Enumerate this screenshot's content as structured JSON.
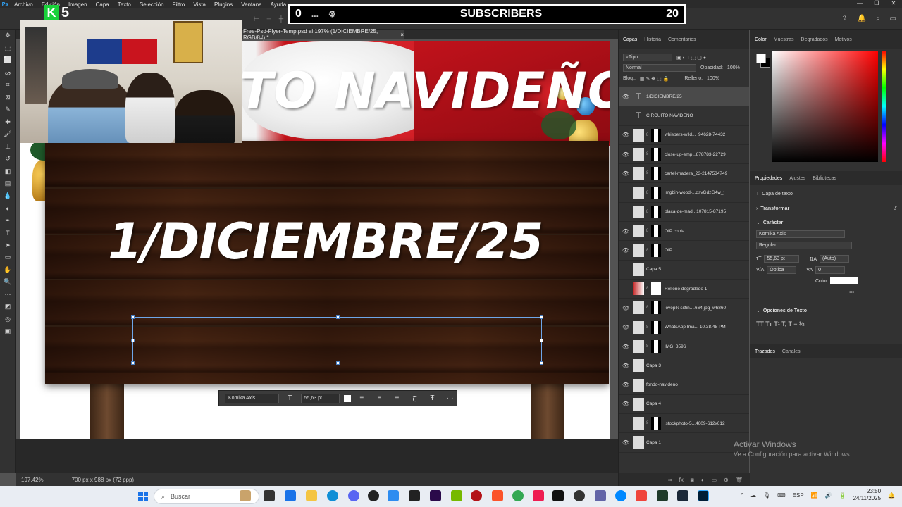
{
  "menubar": {
    "items": [
      "Archivo",
      "Edición",
      "Imagen",
      "Capa",
      "Texto",
      "Selección",
      "Filtro",
      "Vista",
      "Plugins",
      "Ventana",
      "Ayuda"
    ]
  },
  "overlay": {
    "logo_number": "5",
    "count_left": "0",
    "dots": "...",
    "label": "SUBSCRIBERS",
    "count_right": "20"
  },
  "document": {
    "tab_title": "Free-Psd-Flyer-Temp.psd al 197% (1/DICIEMBRE/25, RGB/8#) *",
    "tab_close": "×",
    "sign_title": "CIRCUITO NAVIDEÑO",
    "sign_date": "1/DICIEMBRE/25"
  },
  "float_bar": {
    "font": "Komika Axis",
    "size": "55,63 pt",
    "more": "···"
  },
  "statusbar": {
    "zoom": "197,42%",
    "size": "700 px x 988 px (72 ppp)"
  },
  "layers_panel": {
    "tabs": [
      "Capas",
      "Historia",
      "Comentarios"
    ],
    "filter": "Tipo",
    "blend_mode": "Normal",
    "opacity_label": "Opacidad:",
    "opacity_value": "100%",
    "lock_label": "Bloq.:",
    "fill_label": "Relleno:",
    "fill_value": "100%",
    "layers": [
      {
        "name": "1/DICIEMBRE/25",
        "type": "text",
        "visible": true,
        "selected": true
      },
      {
        "name": "CIRCUITO NAVIDEÑO",
        "type": "text",
        "visible": false,
        "selected": false
      },
      {
        "name": "whispers-wild..._94628-74432",
        "type": "smart",
        "visible": true,
        "selected": false
      },
      {
        "name": "close-up-emp...878783-22729",
        "type": "smart",
        "visible": true,
        "selected": false
      },
      {
        "name": "cartel-madera_23-2147534749",
        "type": "smart",
        "visible": true,
        "selected": false
      },
      {
        "name": "imgbin-wood-...qsvGdzG4w_t",
        "type": "smart",
        "visible": false,
        "selected": false
      },
      {
        "name": "placa-de-mad...107815-87195",
        "type": "smart",
        "visible": false,
        "selected": false
      },
      {
        "name": "OIP copia",
        "type": "smart",
        "visible": true,
        "selected": false
      },
      {
        "name": "OIP",
        "type": "smart",
        "visible": true,
        "selected": false
      },
      {
        "name": "Capa 5",
        "type": "plain",
        "visible": false,
        "selected": false
      },
      {
        "name": "Relleno degradado 1",
        "type": "gradient",
        "visible": false,
        "selected": false
      },
      {
        "name": "lovepik-sittin....664.jpg_wh860",
        "type": "smart",
        "visible": true,
        "selected": false
      },
      {
        "name": "WhatsApp Ima... 10.38.48 PM",
        "type": "smart",
        "visible": true,
        "selected": false
      },
      {
        "name": "IMG_3596",
        "type": "smart",
        "visible": true,
        "selected": false
      },
      {
        "name": "Capa 3",
        "type": "plain",
        "visible": true,
        "selected": false
      },
      {
        "name": "fondo-navideno",
        "type": "plain",
        "visible": true,
        "selected": false
      },
      {
        "name": "Capa 4",
        "type": "plain",
        "visible": true,
        "selected": false
      },
      {
        "name": "istockphoto-5...4609-612x612",
        "type": "smart",
        "visible": false,
        "selected": false
      },
      {
        "name": "Capa 1",
        "type": "plain",
        "visible": true,
        "selected": false
      }
    ]
  },
  "right_panel": {
    "color_tabs": [
      "Color",
      "Muestras",
      "Degradados",
      "Motivos"
    ],
    "prop_tabs": [
      "Propiedades",
      "Ajustes",
      "Bibliotecas"
    ],
    "layer_kind": "Capa de texto",
    "transform_label": "Transformar",
    "character_label": "Carácter",
    "font_family": "Komika Axis",
    "font_style": "Regular",
    "font_size": "55,63 pt",
    "leading": "(Auto)",
    "kerning": "Óptica",
    "tracking": "0",
    "color_label": "Color",
    "text_color": "#ffffff",
    "more": "•••",
    "text_options_label": "Opciones de Texto",
    "text_style_buttons": "TT Tт T¹ T, T ≡ ½",
    "paths_tabs": [
      "Trazados",
      "Canales"
    ]
  },
  "activate_windows": {
    "title": "Activar Windows",
    "subtitle": "Ve a Configuración para activar Windows."
  },
  "taskbar": {
    "search": "Buscar",
    "lang": "ESP",
    "time": "23:50",
    "date": "24/11/2025"
  },
  "colors": {
    "app_bg": "#323232",
    "accent": "#31a8ff",
    "sign_text": "#ffffff"
  }
}
